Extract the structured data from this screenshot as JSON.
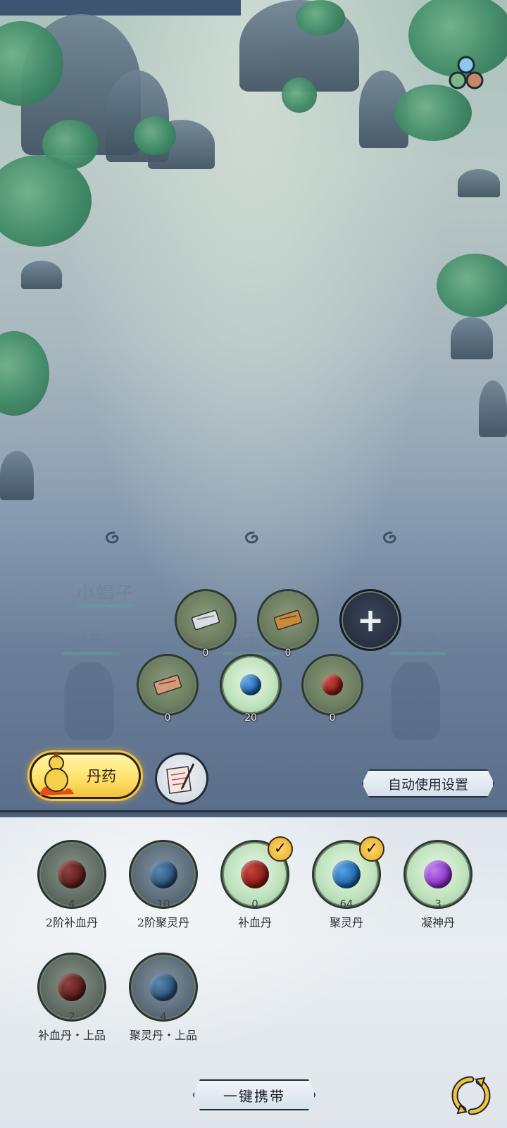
{
  "scene": {
    "ghost_names": [
      "小蝎子",
      "丹朱",
      "白玉",
      "青香"
    ]
  },
  "equipped_slots": [
    {
      "icon": "scroll-icon",
      "count": "0",
      "style": "olive"
    },
    {
      "icon": "scroll-icon",
      "count": "0",
      "style": "olive"
    },
    {
      "icon": "plus-icon",
      "count": "",
      "style": "dark"
    },
    {
      "icon": "scroll-icon",
      "count": "0",
      "style": "olive"
    },
    {
      "icon": "blue-pill-icon",
      "count": "20",
      "style": "green"
    },
    {
      "icon": "red-pill-icon",
      "count": "0",
      "style": "olive"
    }
  ],
  "tabs": {
    "medicine_label": "丹药",
    "recipe_icon": "recipe-scroll-icon"
  },
  "auto_use_label": "自动使用设置",
  "inventory": [
    {
      "name": "2阶补血丹",
      "count": "4",
      "color": "red",
      "style": "dark",
      "checked": false
    },
    {
      "name": "2阶聚灵丹",
      "count": "10",
      "color": "blue",
      "style": "dark",
      "checked": false
    },
    {
      "name": "补血丹",
      "count": "0",
      "color": "red",
      "style": "green",
      "checked": true
    },
    {
      "name": "聚灵丹",
      "count": "64",
      "color": "blue",
      "style": "green",
      "checked": true
    },
    {
      "name": "凝神丹",
      "count": "3",
      "color": "purple",
      "style": "green",
      "checked": false
    },
    {
      "name": "补血丹・上品",
      "count": "2",
      "color": "red",
      "style": "dark",
      "checked": false
    },
    {
      "name": "聚灵丹・上品",
      "count": "4",
      "color": "blue",
      "style": "dark",
      "checked": false
    }
  ],
  "carry_label": "一键携带",
  "colors": {
    "accent_gold": "#f5c542",
    "panel_bg": "#e4eaef",
    "dark_outline": "#25303e"
  }
}
